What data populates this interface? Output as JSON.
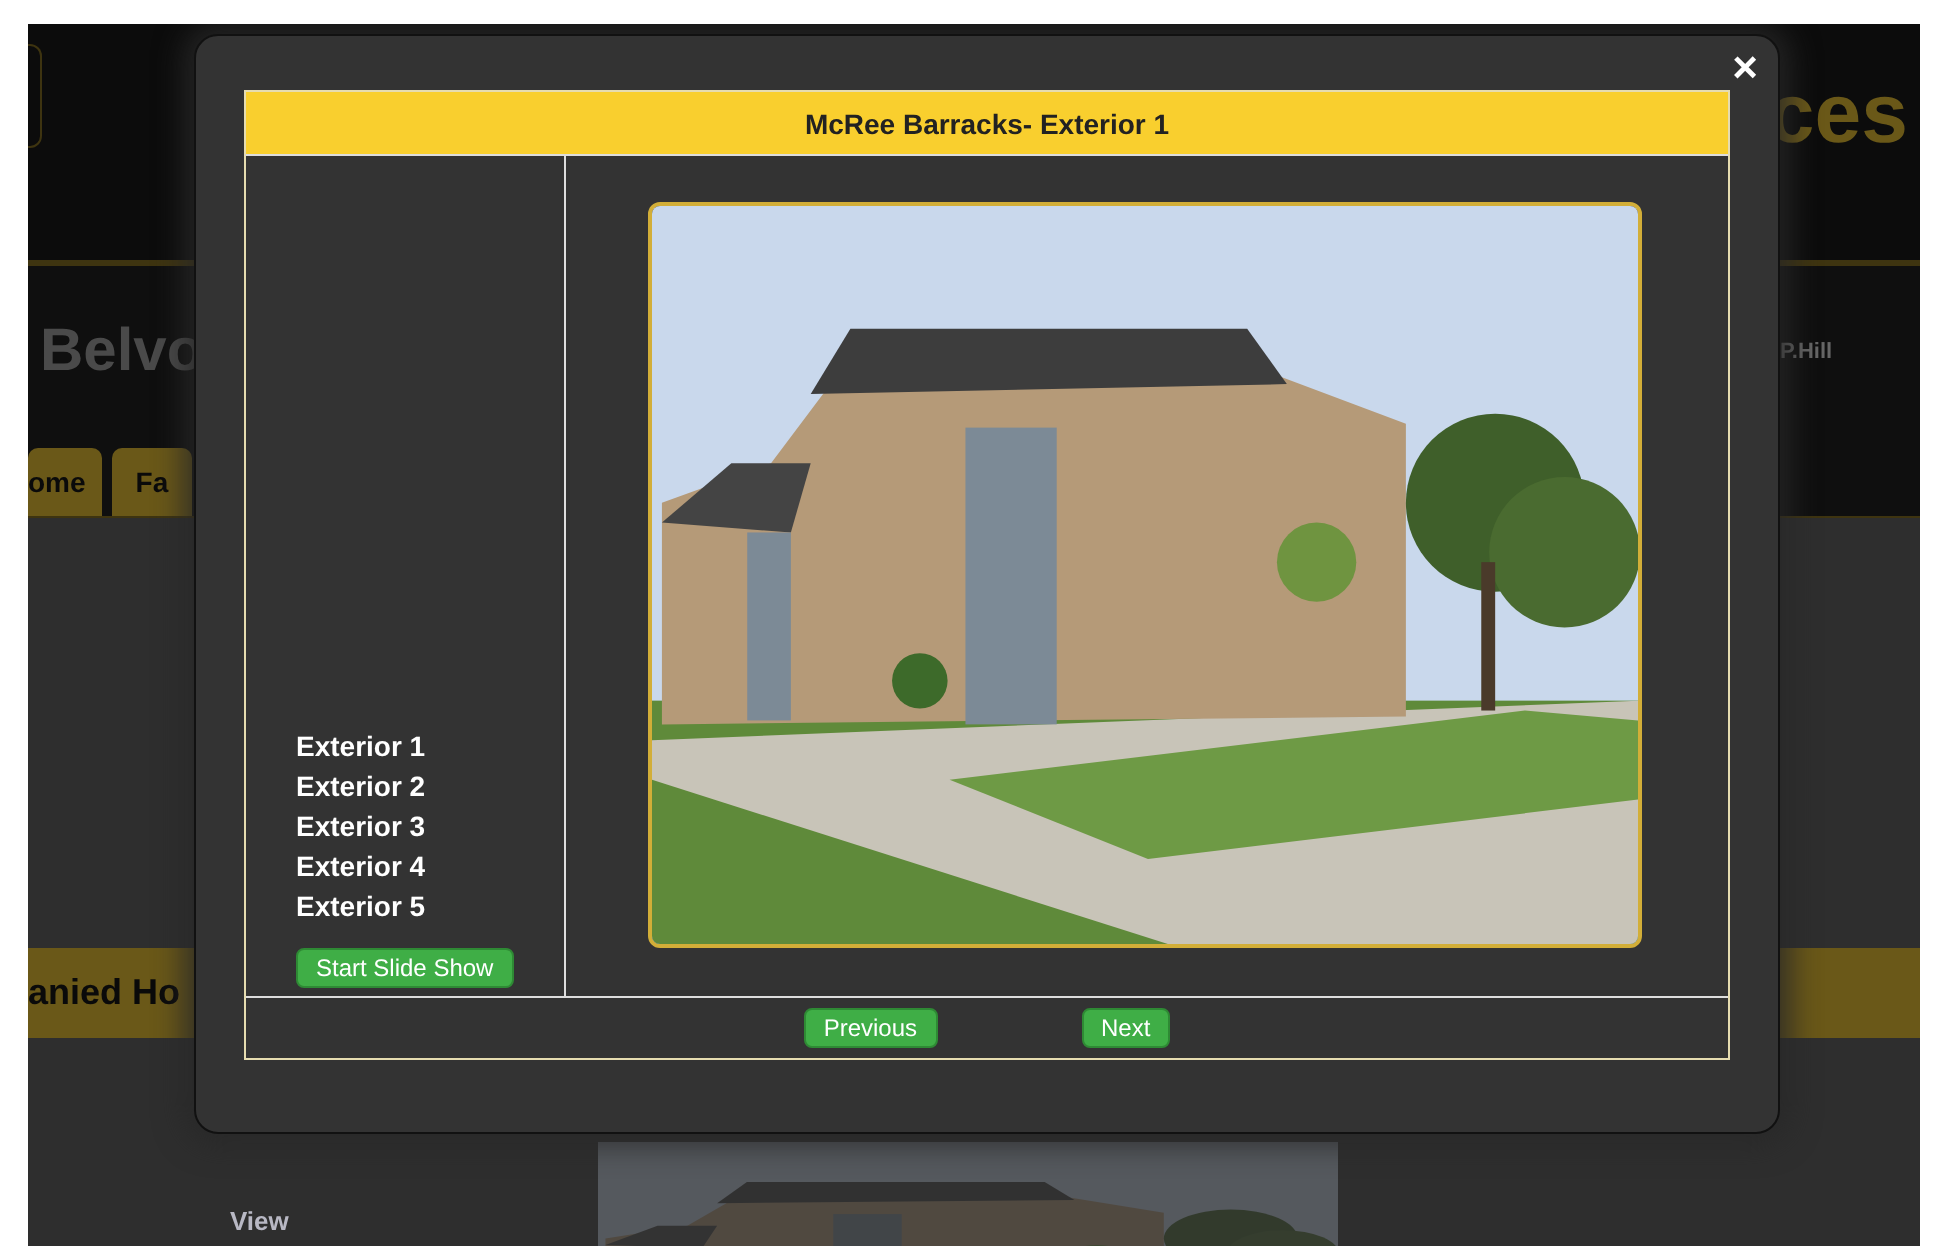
{
  "background_page": {
    "header_title": "ces",
    "site_name": "Belvo",
    "info_text": "P.Hill",
    "tabs": [
      {
        "label": "ome"
      },
      {
        "label": "Fa"
      }
    ],
    "section_title": "anied Ho",
    "view_label": "View"
  },
  "dialog": {
    "close": "×",
    "title": "McRee Barracks- Exterior 1",
    "photos": [
      {
        "label": "Exterior 1"
      },
      {
        "label": "Exterior 2"
      },
      {
        "label": "Exterior 3"
      },
      {
        "label": "Exterior 4"
      },
      {
        "label": "Exterior 5"
      }
    ],
    "slideshow_button": "Start Slide Show",
    "buttons": [
      "Previous",
      "Next"
    ]
  }
}
